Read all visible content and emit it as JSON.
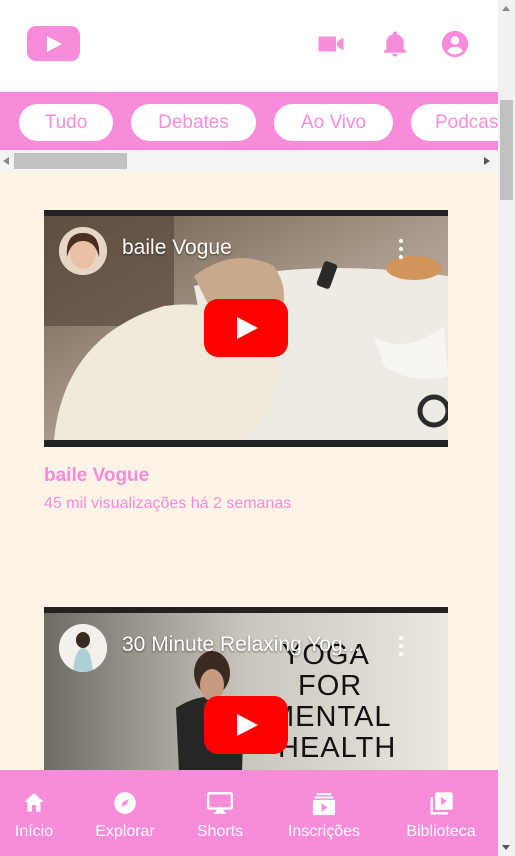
{
  "header": {
    "logo_icon": "youtube-play-logo",
    "actions": [
      {
        "name": "video-camera-icon"
      },
      {
        "name": "bell-icon"
      },
      {
        "name": "account-icon"
      }
    ]
  },
  "chips": [
    "Tudo",
    "Debates",
    "Ao Vivo",
    "Podcasts"
  ],
  "videos": [
    {
      "overlay_title": "baile Vogue",
      "title": "baile Vogue",
      "stats": "45 mil visualizações há 2 semanas"
    },
    {
      "overlay_title": "30 Minute Relaxing Yog...",
      "thumb_text": [
        "YOGA",
        "FOR",
        "MENTAL",
        "HEALTH"
      ]
    }
  ],
  "nav": [
    {
      "label": "Início",
      "icon": "home-icon"
    },
    {
      "label": "Explorar",
      "icon": "compass-icon"
    },
    {
      "label": "Shorts",
      "icon": "shorts-icon"
    },
    {
      "label": "Inscrições",
      "icon": "subscriptions-icon"
    },
    {
      "label": "Biblioteca",
      "icon": "library-icon"
    }
  ],
  "colors": {
    "accent": "#f98bdb",
    "feed_bg": "#fdf3e6",
    "play_red": "#ff0000"
  }
}
